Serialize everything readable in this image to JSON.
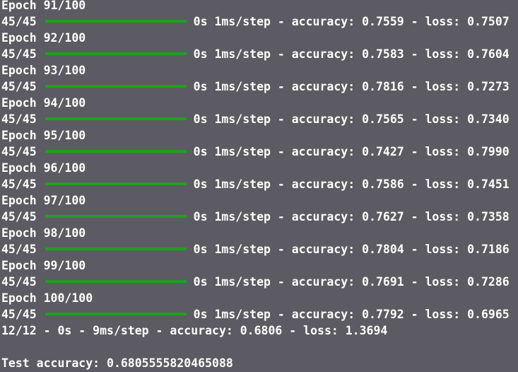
{
  "colors": {
    "background": "#5c5b63",
    "text": "#ffffff",
    "progress_bar": "#1fa01f"
  },
  "epochs": [
    {
      "header": "Epoch 91/100",
      "steps": "45/45",
      "metrics": "0s 1ms/step - accuracy: 0.7559 - loss: 0.7507",
      "progress": 1.0
    },
    {
      "header": "Epoch 92/100",
      "steps": "45/45",
      "metrics": "0s 1ms/step - accuracy: 0.7583 - loss: 0.7604",
      "progress": 1.0
    },
    {
      "header": "Epoch 93/100",
      "steps": "45/45",
      "metrics": "0s 1ms/step - accuracy: 0.7816 - loss: 0.7273",
      "progress": 1.0
    },
    {
      "header": "Epoch 94/100",
      "steps": "45/45",
      "metrics": "0s 1ms/step - accuracy: 0.7565 - loss: 0.7340",
      "progress": 1.0
    },
    {
      "header": "Epoch 95/100",
      "steps": "45/45",
      "metrics": "0s 1ms/step - accuracy: 0.7427 - loss: 0.7990",
      "progress": 1.0
    },
    {
      "header": "Epoch 96/100",
      "steps": "45/45",
      "metrics": "0s 1ms/step - accuracy: 0.7586 - loss: 0.7451",
      "progress": 1.0
    },
    {
      "header": "Epoch 97/100",
      "steps": "45/45",
      "metrics": "0s 1ms/step - accuracy: 0.7627 - loss: 0.7358",
      "progress": 1.0
    },
    {
      "header": "Epoch 98/100",
      "steps": "45/45",
      "metrics": "0s 1ms/step - accuracy: 0.7804 - loss: 0.7186",
      "progress": 1.0
    },
    {
      "header": "Epoch 99/100",
      "steps": "45/45",
      "metrics": "0s 1ms/step - accuracy: 0.7691 - loss: 0.7286",
      "progress": 1.0
    },
    {
      "header": "Epoch 100/100",
      "steps": "45/45",
      "metrics": "0s 1ms/step - accuracy: 0.7792 - loss: 0.6965",
      "progress": 1.0
    }
  ],
  "evaluation": "12/12 - 0s - 9ms/step - accuracy: 0.6806 - loss: 1.3694",
  "test_accuracy": "Test accuracy: 0.6805555820465088"
}
